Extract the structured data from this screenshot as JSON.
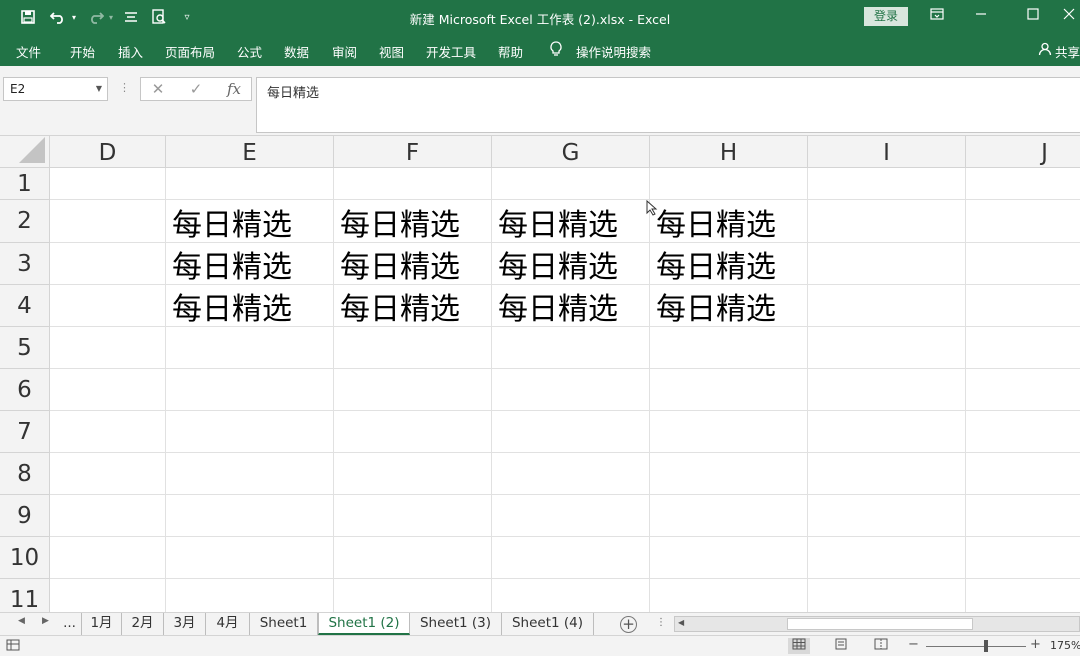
{
  "window": {
    "title": "新建 Microsoft Excel 工作表 (2).xlsx  -  Excel",
    "login_label": "登录",
    "qat_icons": [
      "save-icon",
      "undo-icon",
      "redo-icon",
      "form-icon",
      "print-preview-icon",
      "customize-qat-icon"
    ],
    "controls": [
      "ribbon-display-icon",
      "minimize-icon",
      "maximize-icon",
      "close-icon"
    ]
  },
  "ribbon": {
    "tabs": [
      "文件",
      "开始",
      "插入",
      "页面布局",
      "公式",
      "数据",
      "审阅",
      "视图",
      "开发工具",
      "帮助"
    ],
    "tell_me": "操作说明搜索",
    "share": "共享"
  },
  "formula_bar": {
    "name_box": "E2",
    "cancel": "✕",
    "enter": "✓",
    "fx": "fx",
    "value": "每日精选"
  },
  "grid": {
    "columns": [
      "D",
      "E",
      "F",
      "G",
      "H",
      "I",
      "J"
    ],
    "rows": [
      "1",
      "2",
      "3",
      "4",
      "5",
      "6",
      "7",
      "8",
      "9",
      "10",
      "11"
    ],
    "cells": [
      [
        "",
        "",
        "",
        "",
        "",
        "",
        ""
      ],
      [
        "",
        "每日精选",
        "每日精选",
        "每日精选",
        "每日精选",
        "",
        ""
      ],
      [
        "",
        "每日精选",
        "每日精选",
        "每日精选",
        "每日精选",
        "",
        ""
      ],
      [
        "",
        "每日精选",
        "每日精选",
        "每日精选",
        "每日精选",
        "",
        ""
      ]
    ],
    "selected_cell": "E2"
  },
  "sheet_tabs": {
    "overflow": "...",
    "tabs": [
      "1月",
      "2月",
      "3月",
      "4月",
      "Sheet1",
      "Sheet1 (2)",
      "Sheet1 (3)",
      "Sheet1 (4)"
    ],
    "active": "Sheet1 (2)"
  },
  "status_bar": {
    "zoom": "175%"
  },
  "colors": {
    "accent": "#217346",
    "header_bg": "#f3f3f3",
    "gridline": "#e1e1e1"
  }
}
